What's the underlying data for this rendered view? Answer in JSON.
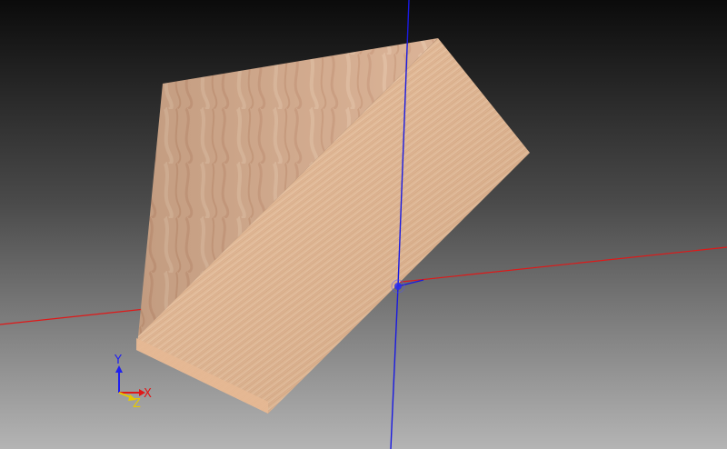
{
  "viewport": {
    "background_top": "#0b0b0b",
    "background_bottom": "#b4b4b4"
  },
  "model": {
    "shape": "wooden wedge / triangular prism",
    "front_face_color_light": "#f2c9a3",
    "front_face_color_dark": "#d9a07a",
    "side_face_color_light": "#e3bc9f",
    "side_face_color_dark": "#c99474"
  },
  "world_axes": {
    "x_color": "#e01818",
    "y_color": "#1a1ae0",
    "origin_marker_color": "#2a2af0"
  },
  "orientation_gizmo": {
    "x_label": "X",
    "y_label": "Y",
    "z_label": "Z",
    "x_color": "#e01818",
    "y_color": "#2020f0",
    "z_color": "#e6c800"
  }
}
